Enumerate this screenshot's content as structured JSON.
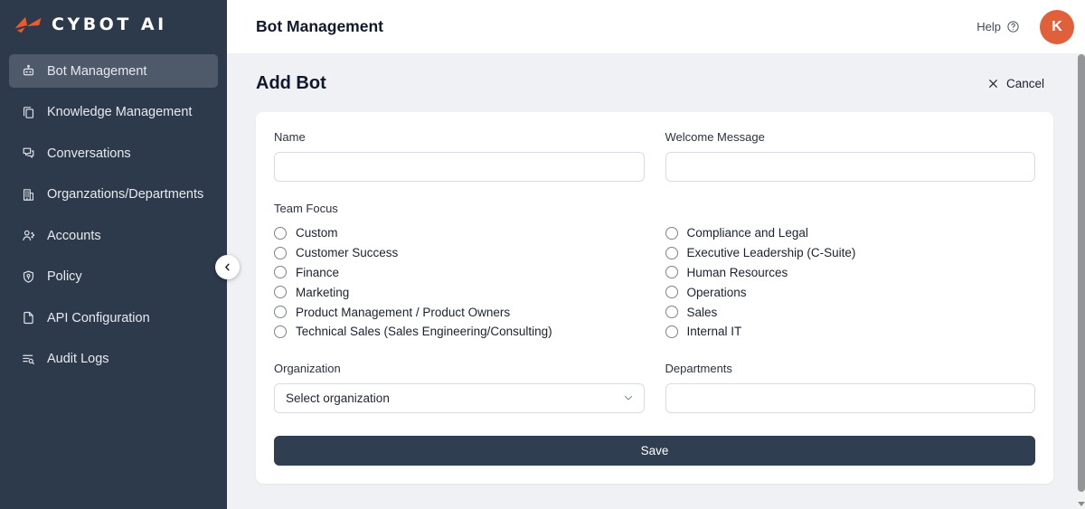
{
  "brand": {
    "name": "CYBOT AI",
    "logo_icon": "wing-icon"
  },
  "sidebar": {
    "items": [
      {
        "id": "bot-management",
        "label": "Bot Management",
        "icon": "bot-icon",
        "active": true
      },
      {
        "id": "knowledge-management",
        "label": "Knowledge Management",
        "icon": "knowledge-icon",
        "active": false
      },
      {
        "id": "conversations",
        "label": "Conversations",
        "icon": "conversations-icon",
        "active": false
      },
      {
        "id": "organizations-departments",
        "label": "Organzations/Departments",
        "icon": "organizations-icon",
        "active": false
      },
      {
        "id": "accounts",
        "label": "Accounts",
        "icon": "accounts-icon",
        "active": false
      },
      {
        "id": "policy",
        "label": "Policy",
        "icon": "policy-icon",
        "active": false
      },
      {
        "id": "api-configuration",
        "label": "API Configuration",
        "icon": "api-icon",
        "active": false
      },
      {
        "id": "audit-logs",
        "label": "Audit Logs",
        "icon": "audit-logs-icon",
        "active": false
      }
    ],
    "collapse_icon": "chevron-left-icon"
  },
  "header": {
    "title": "Bot Management",
    "help_label": "Help",
    "help_icon": "question-circle-icon",
    "avatar_initial": "K"
  },
  "page": {
    "title": "Add Bot",
    "cancel": {
      "label": "Cancel",
      "icon": "close-icon"
    },
    "form": {
      "name": {
        "label": "Name",
        "value": ""
      },
      "welcome_message": {
        "label": "Welcome Message",
        "value": ""
      },
      "team_focus": {
        "label": "Team Focus",
        "selected": null,
        "options_left": [
          "Custom",
          "Customer Success",
          "Finance",
          "Marketing",
          "Product Management / Product Owners",
          "Technical Sales (Sales Engineering/Consulting)"
        ],
        "options_right": [
          "Compliance and Legal",
          "Executive Leadership (C-Suite)",
          "Human Resources",
          "Operations",
          "Sales",
          "Internal IT"
        ]
      },
      "organization": {
        "label": "Organization",
        "selected_value": "Select organization",
        "dropdown_icon": "chevron-down-icon"
      },
      "departments": {
        "label": "Departments",
        "value": ""
      },
      "save_label": "Save"
    }
  },
  "colors": {
    "accent_orange": "#EE5A29",
    "avatar_orange": "#E0603C",
    "sidebar_bg": "#2C3A4B",
    "sidebar_active_bg": "#4E5969",
    "save_button_bg": "#2F3E51",
    "page_bg": "#F0F1F5"
  }
}
